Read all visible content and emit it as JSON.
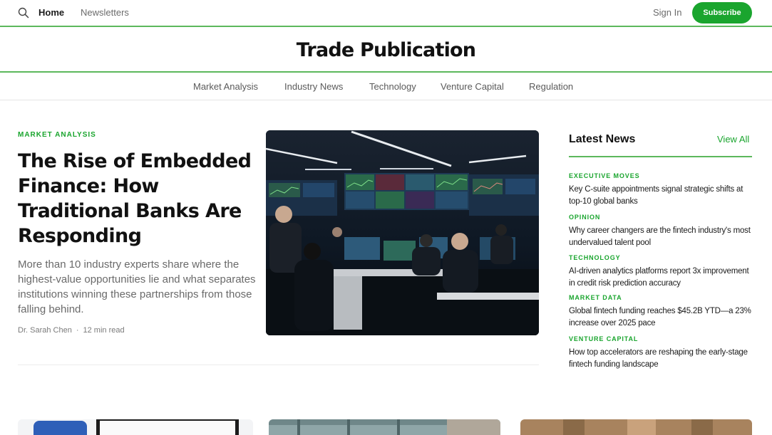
{
  "topbar": {
    "nav": [
      {
        "label": "Home"
      },
      {
        "label": "Newsletters"
      }
    ],
    "signin_label": "Sign In",
    "subscribe_label": "Subscribe"
  },
  "masthead": {
    "title": "Trade Publication"
  },
  "categories": [
    "Market Analysis",
    "Industry News",
    "Technology",
    "Venture Capital",
    "Regulation"
  ],
  "feature": {
    "kicker": "MARKET ANALYSIS",
    "headline": "The Rise of Embedded Finance: How Traditional Banks Are Responding",
    "dek": "More than 10 industry experts share where the highest-value opportunities lie and what separates institutions winning these partnerships from those falling behind.",
    "author": "Dr. Sarah Chen",
    "read_time": "12 min read"
  },
  "latest": {
    "title": "Latest News",
    "view_all_label": "View All",
    "items": [
      {
        "category": "EXECUTIVE MOVES",
        "headline": "Key C-suite appointments signal strategic shifts at top-10 global banks"
      },
      {
        "category": "OPINION",
        "headline": "Why career changers are the fintech industry's most undervalued talent pool"
      },
      {
        "category": "TECHNOLOGY",
        "headline": "AI-driven analytics platforms report 3x improvement in credit risk prediction accuracy"
      },
      {
        "category": "MARKET DATA",
        "headline": "Global fintech funding reaches $45.2B YTD—a 23% increase over 2025 pace"
      },
      {
        "category": "VENTURE CAPITAL",
        "headline": "How top accelerators are reshaping the early-stage fintech funding landscape"
      }
    ]
  },
  "colors": {
    "accent": "#1aa52e",
    "rule": "#5cb85c"
  },
  "icons": {
    "search": "search-icon"
  }
}
